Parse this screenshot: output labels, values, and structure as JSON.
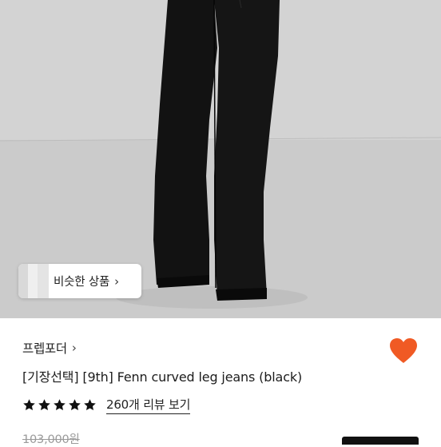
{
  "product_image": {
    "alt_icon": "product-photo"
  },
  "similar_products": {
    "label": "비슷한 상품",
    "chevron": "›"
  },
  "seller": {
    "name": "프렙포더",
    "chevron": "›"
  },
  "wishlist": {
    "icon": "heart-icon",
    "color": "#f05a24"
  },
  "product": {
    "title": "[기장선택] [9th] Fenn curved leg jeans (black)",
    "rating_stars": 5,
    "review_link": "260개 리뷰 보기",
    "original_price": "103,000원"
  },
  "colors": {
    "accent": "#f05a24",
    "star": "#111111"
  }
}
